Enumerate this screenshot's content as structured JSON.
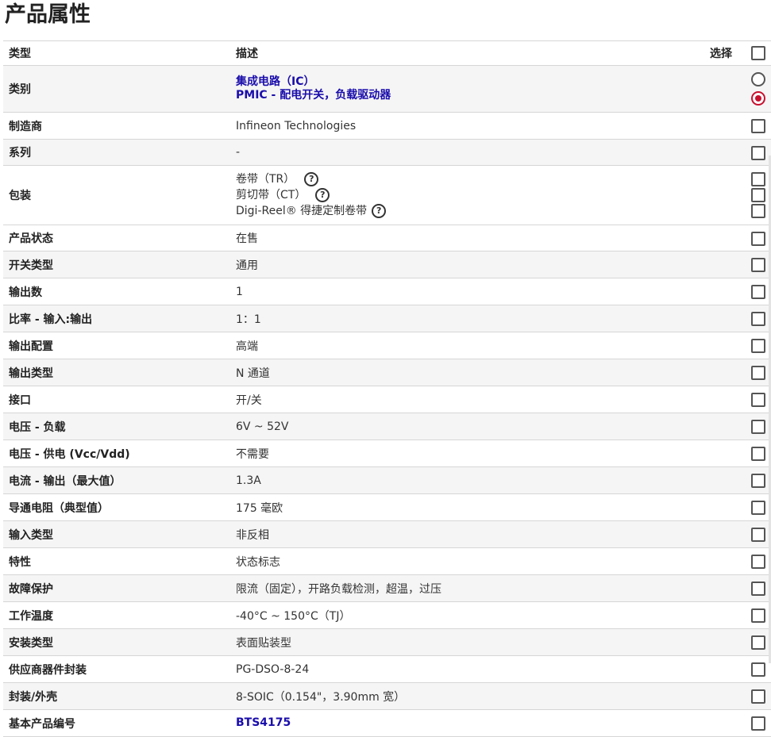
{
  "title": "产品属性",
  "header": {
    "type": "类型",
    "description": "描述",
    "select": "选择"
  },
  "category": {
    "label": "类别",
    "links": [
      "集成电路（IC）",
      "PMIC - 配电开关，负载驱动器"
    ]
  },
  "manufacturer": {
    "label": "制造商",
    "value": "Infineon Technologies"
  },
  "series": {
    "label": "系列",
    "value": "-"
  },
  "packaging": {
    "label": "包装",
    "options": [
      "卷带（TR）",
      "剪切带（CT）",
      "Digi-Reel® 得捷定制卷带"
    ]
  },
  "rows": [
    {
      "label": "产品状态",
      "value": "在售"
    },
    {
      "label": "开关类型",
      "value": "通用"
    },
    {
      "label": "输出数",
      "value": "1"
    },
    {
      "label": "比率 - 输入:输出",
      "value": "1：1"
    },
    {
      "label": "输出配置",
      "value": "高端"
    },
    {
      "label": "输出类型",
      "value": "N 通道"
    },
    {
      "label": "接口",
      "value": "开/关"
    },
    {
      "label": "电压 - 负载",
      "value": "6V ~ 52V"
    },
    {
      "label": "电压 - 供电 (Vcc/Vdd)",
      "value": "不需要"
    },
    {
      "label": "电流 - 输出（最大值）",
      "value": "1.3A"
    },
    {
      "label": "导通电阻（典型值）",
      "value": "175 毫欧"
    },
    {
      "label": "输入类型",
      "value": "非反相"
    },
    {
      "label": "特性",
      "value": "状态标志"
    },
    {
      "label": "故障保护",
      "value": "限流（固定），开路负载检测，超温，过压"
    },
    {
      "label": "工作温度",
      "value": "-40°C ~ 150°C（TJ）"
    },
    {
      "label": "安装类型",
      "value": "表面贴装型"
    },
    {
      "label": "供应商器件封装",
      "value": "PG-DSO-8-24"
    },
    {
      "label": "封装/外壳",
      "value": "8-SOIC（0.154\"，3.90mm 宽）"
    }
  ],
  "base_part": {
    "label": "基本产品编号",
    "value": "BTS4175"
  },
  "colors": {
    "link": "#1a0dab",
    "radio_selected": "#c8102e",
    "stripe": "#f5f5f5"
  }
}
